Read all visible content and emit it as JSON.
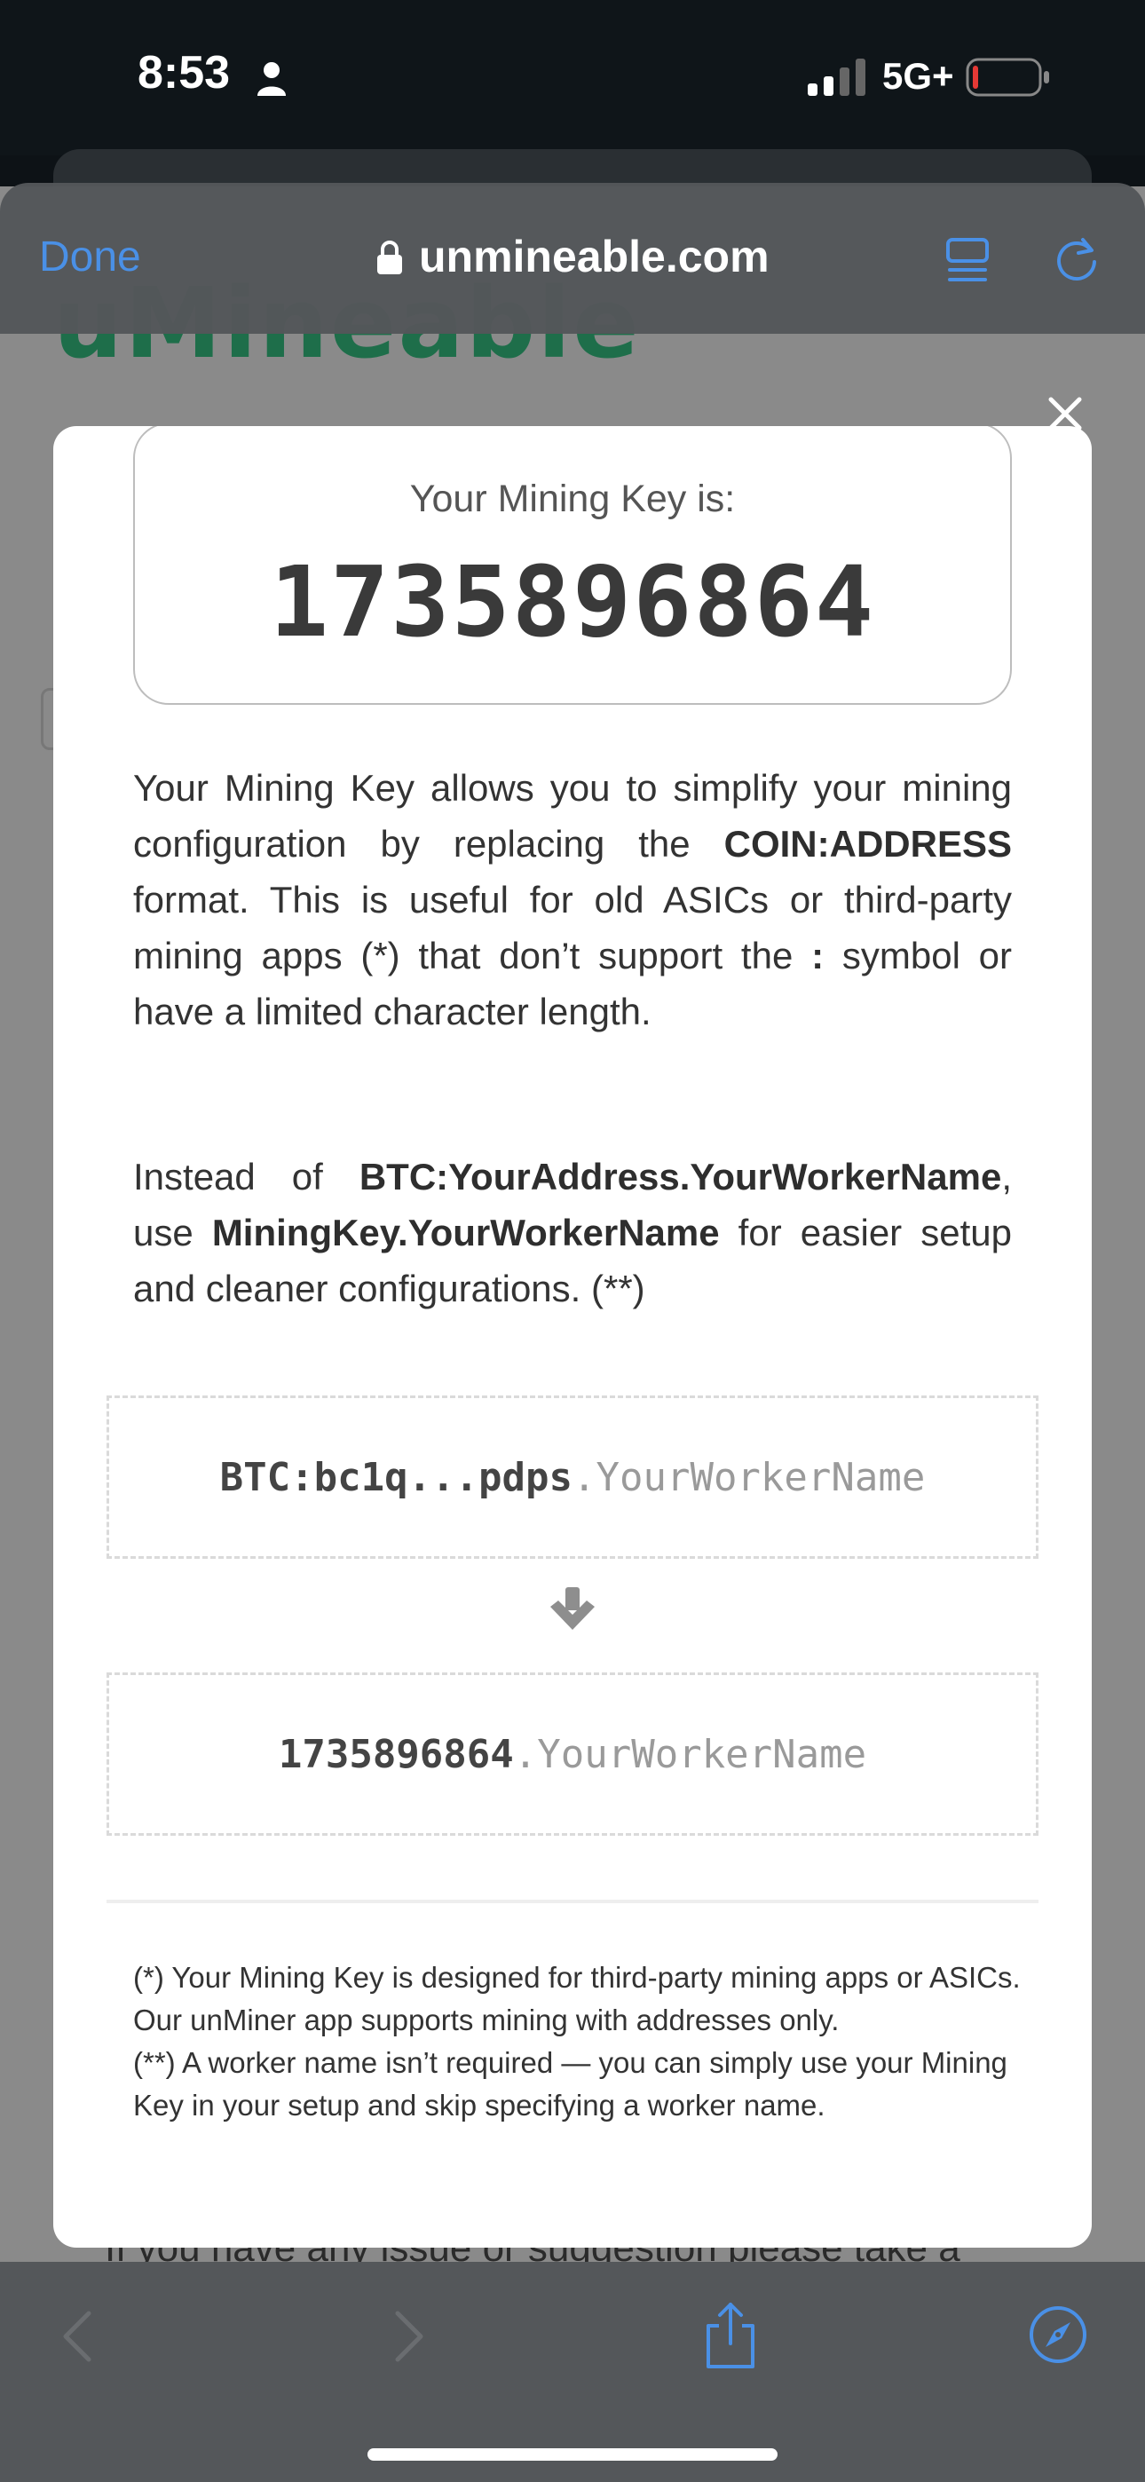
{
  "status_bar": {
    "time": "8:53",
    "network": "5G+"
  },
  "browser": {
    "done_label": "Done",
    "url": "unmineable.com"
  },
  "background_page": {
    "logo_text": "uMineable",
    "footer_text": "If you have any issue or suggestion please take a"
  },
  "modal": {
    "key_label": "Your Mining Key is:",
    "key_value": "1735896864",
    "paragraph1": {
      "part1": "Your Mining Key allows you to simplify your mining configuration by replacing the ",
      "bold1": "COIN:ADDRESS",
      "part2": " format. This is useful for old ASICs or third-party mining apps (*) that don’t support the ",
      "bold2": ":",
      "part3": " symbol or have a limited character length."
    },
    "paragraph2": {
      "part1": "Instead of ",
      "bold1": "BTC:YourAddress.YourWorkerName",
      "part2": ", use ",
      "bold2": "MiningKey.YourWorkerName",
      "part3": " for easier setup and cleaner configurations. (**)"
    },
    "example_before": {
      "prefix": "BTC:bc1q...pdps",
      "suffix": ".YourWorkerName"
    },
    "example_after": {
      "prefix": "1735896864",
      "suffix": ".YourWorkerName"
    },
    "footnote1": "(*) Your Mining Key is designed for third-party mining apps or ASICs. Our unMiner app supports mining with addresses only.",
    "footnote2": "(**) A worker name isn’t required — you can simply use your Mining Key in your setup and skip specifying a worker name."
  },
  "icons": {
    "close": "close-icon",
    "arrow": "arrow-down-icon",
    "lock": "lock-icon",
    "reader": "reader-icon",
    "reload": "reload-icon",
    "back": "chevron-left-icon",
    "forward": "chevron-right-icon",
    "share": "share-icon",
    "compass": "compass-icon"
  },
  "colors": {
    "accent": "#4a90e6",
    "toolbar": "#54575a",
    "battery_low": "#e53935"
  }
}
